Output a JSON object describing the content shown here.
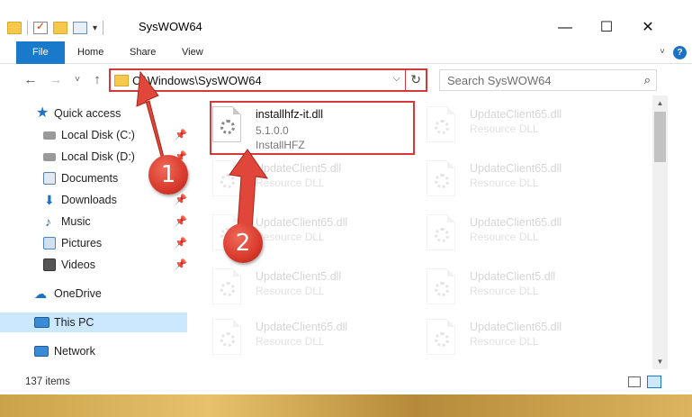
{
  "window": {
    "title": "SysWOW64",
    "controls": {
      "minimize": "—",
      "maximize": "☐",
      "close": "✕"
    }
  },
  "ribbon": {
    "tabs": [
      "File",
      "Home",
      "Share",
      "View"
    ],
    "help": "?"
  },
  "nav": {
    "back": "←",
    "forward": "→",
    "recent": "˅",
    "up": "↑",
    "address": "C:\\Windows\\SysWOW64",
    "search_placeholder": "Search SysWOW64"
  },
  "sidebar": {
    "items": [
      {
        "label": "Quick access",
        "icon": "star-icon",
        "color": "#1e72c6"
      },
      {
        "label": "Local Disk (C:)",
        "icon": "drive-icon",
        "color": "#8a8a8a",
        "pinned": true
      },
      {
        "label": "Local Disk (D:)",
        "icon": "drive-icon",
        "color": "#8a8a8a",
        "pinned": true
      },
      {
        "label": "Documents",
        "icon": "documents-icon",
        "color": "#5c7fa8",
        "pinned": true
      },
      {
        "label": "Downloads",
        "icon": "downloads-icon",
        "color": "#1e72c6",
        "pinned": true
      },
      {
        "label": "Music",
        "icon": "music-icon",
        "color": "#1e72c6",
        "pinned": true
      },
      {
        "label": "Pictures",
        "icon": "pictures-icon",
        "color": "#4f83bb",
        "pinned": true
      },
      {
        "label": "Videos",
        "icon": "videos-icon",
        "color": "#444444",
        "pinned": true
      },
      {
        "label": "OneDrive",
        "icon": "onedrive-icon",
        "color": "#1e72c6"
      },
      {
        "label": "This PC",
        "icon": "pc-icon",
        "color": "#3a8ad6",
        "selected": true
      },
      {
        "label": "Network",
        "icon": "network-icon",
        "color": "#3a8ad6"
      }
    ]
  },
  "files": [
    {
      "name": "installhfz-it.dll",
      "line2": "5.1.0.0",
      "line3": "InstallHFZ",
      "highlighted": true
    },
    {
      "name": "UpdateClient65.dll",
      "line2": "Resource DLL"
    },
    {
      "name": "UpdateClient5.dll",
      "line2": "Resource DLL"
    },
    {
      "name": "UpdateClient65.dll",
      "line2": "Resource DLL"
    },
    {
      "name": "UpdateClient65.dll",
      "line2": "Resource DLL"
    },
    {
      "name": "UpdateClient65.dll",
      "line2": "Resource DLL"
    },
    {
      "name": "UpdateClient5.dll",
      "line2": "Resource DLL"
    },
    {
      "name": "UpdateClient5.dll",
      "line2": "Resource DLL"
    },
    {
      "name": "UpdateClient65.dll",
      "line2": "Resource DLL"
    },
    {
      "name": "UpdateClient65.dll",
      "line2": "Resource DLL"
    }
  ],
  "status": {
    "item_count": "137 items"
  },
  "annotations": {
    "step1": "1",
    "step2": "2",
    "color": "#d6393b"
  }
}
